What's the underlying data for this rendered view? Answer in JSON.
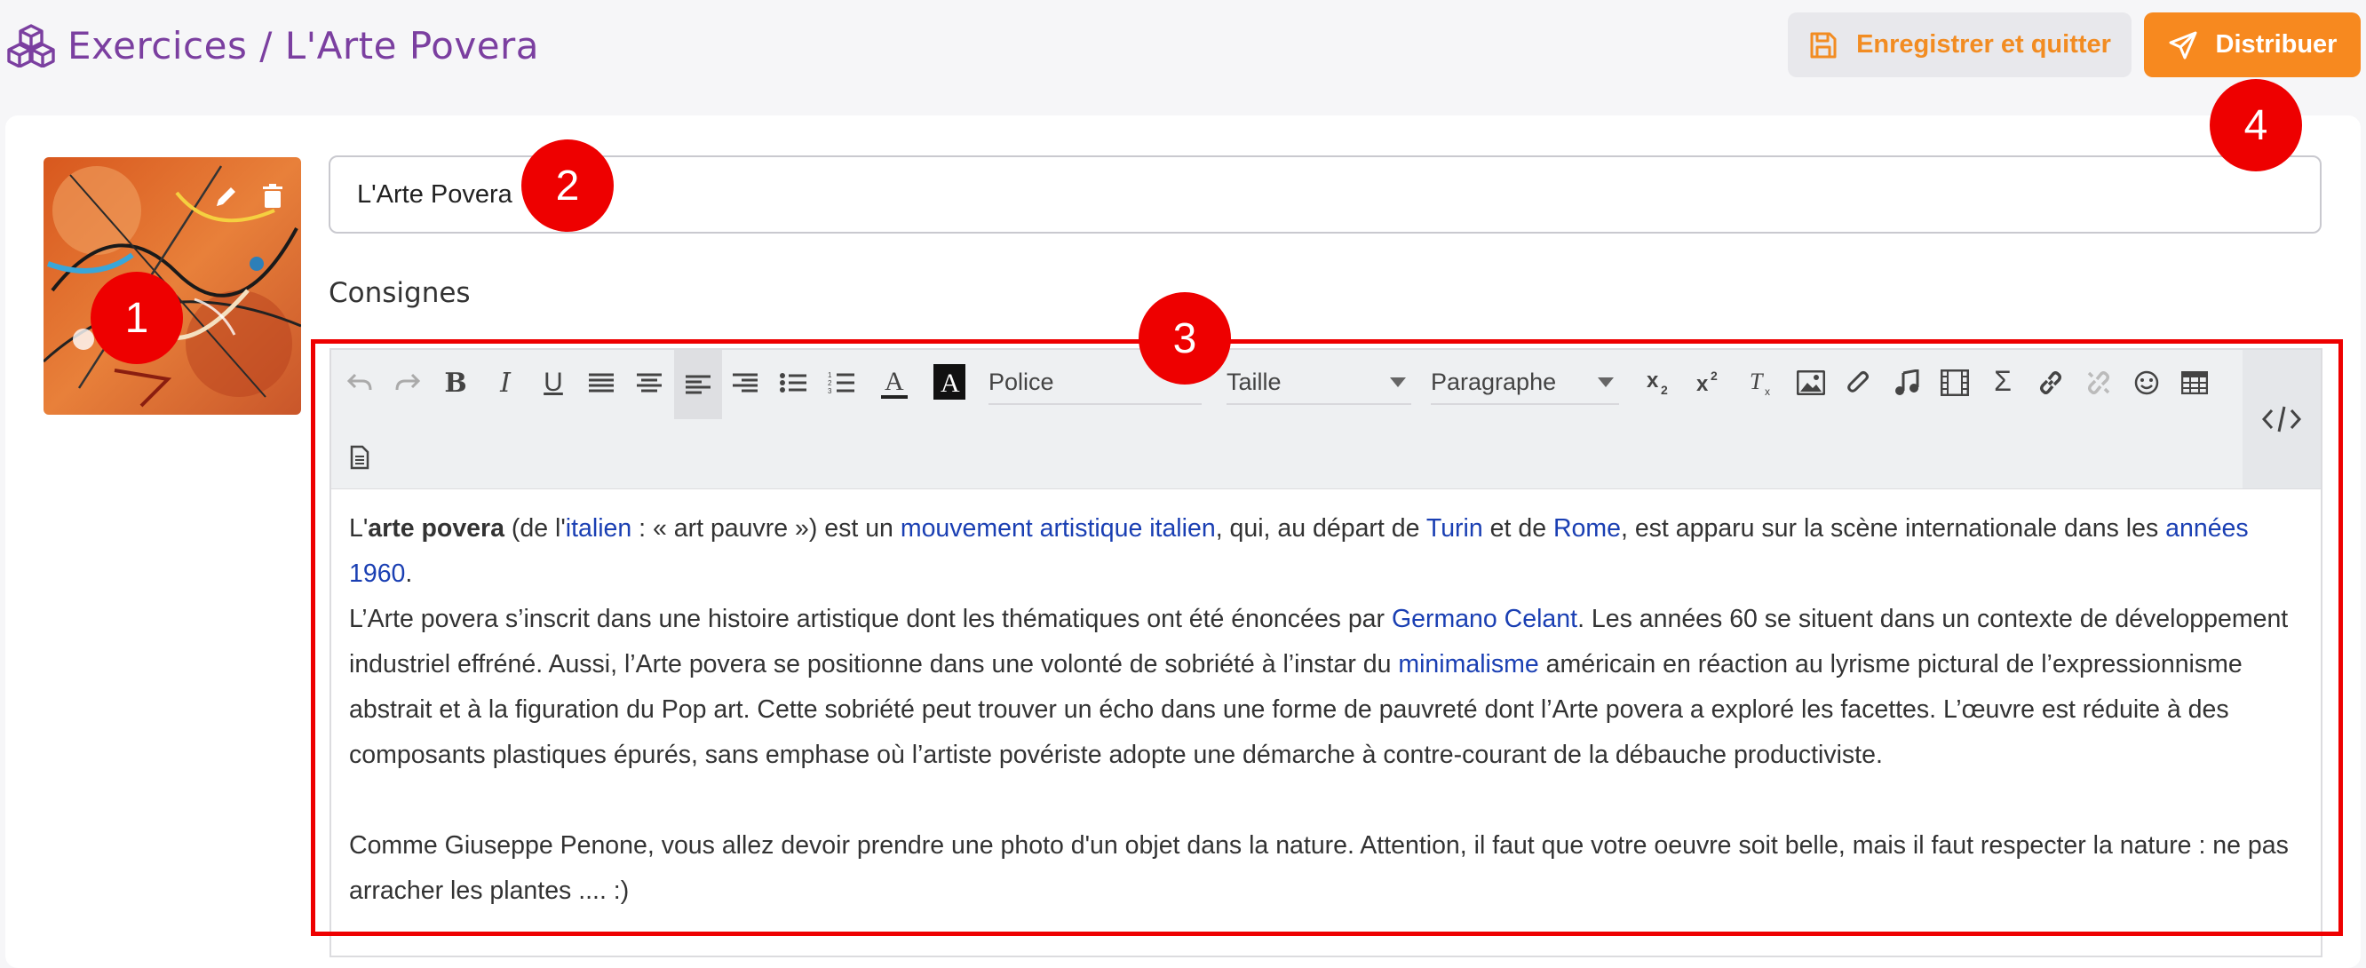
{
  "breadcrumb": {
    "text": "Exercices / L'Arte Povera"
  },
  "actions": {
    "save_label": "Enregistrer et quitter",
    "distribute_label": "Distribuer"
  },
  "form": {
    "title_value": "L'Arte Povera",
    "instructions_label": "Consignes"
  },
  "toolbar": {
    "font_label": "Police",
    "size_label": "Taille",
    "format_label": "Paragraphe"
  },
  "content": {
    "p1": {
      "s1": "L'",
      "s2": "arte povera",
      "s3": " (de l'",
      "s4": "italien",
      "s5": " : « art pauvre ») est un ",
      "s6": "mouvement artistique italien",
      "s7": ", qui, au départ de ",
      "s8": "Turin",
      "s9": " et de ",
      "s10": "Rome",
      "s11": ", est apparu sur la scène internationale dans les ",
      "s12": "années 1960",
      "s13": "."
    },
    "p2": {
      "s1": "L’Arte povera s’inscrit dans une histoire artistique dont les thématiques ont été énoncées par ",
      "s2": "Germano Celant",
      "s3": ". Les années 60 se situent dans un contexte de développement industriel effréné. Aussi, l’Arte povera se positionne dans une volonté de sobriété à l’instar du ",
      "s4": "minimalisme",
      "s5": " américain en réaction au lyrisme pictural de l’expressionnisme abstrait et à la figuration du Pop art. Cette sobriété peut trouver un écho dans une forme de pauvreté dont l’Arte povera a exploré les facettes. L’œuvre est réduite à des composants plastiques épurés, sans emphase où l’artiste povériste adopte une démarche à contre-courant de la débauche productiviste."
    },
    "p3": "Comme Giuseppe Penone, vous allez devoir prendre une photo d'un objet dans la nature. Attention, il faut que votre oeuvre soit belle, mais il faut respecter la nature : ne pas arracher les plantes .... :)"
  },
  "markers": {
    "m1": "1",
    "m2": "2",
    "m3": "3",
    "m4": "4"
  },
  "colors": {
    "accent": "#f7891f",
    "title": "#7b3fa0",
    "link": "#1a3fb3",
    "highlight": "#ee0000"
  },
  "icons": [
    "cubes-icon",
    "floppy-disk-icon",
    "paper-plane-icon",
    "pencil-icon",
    "trash-icon",
    "code-icon"
  ]
}
